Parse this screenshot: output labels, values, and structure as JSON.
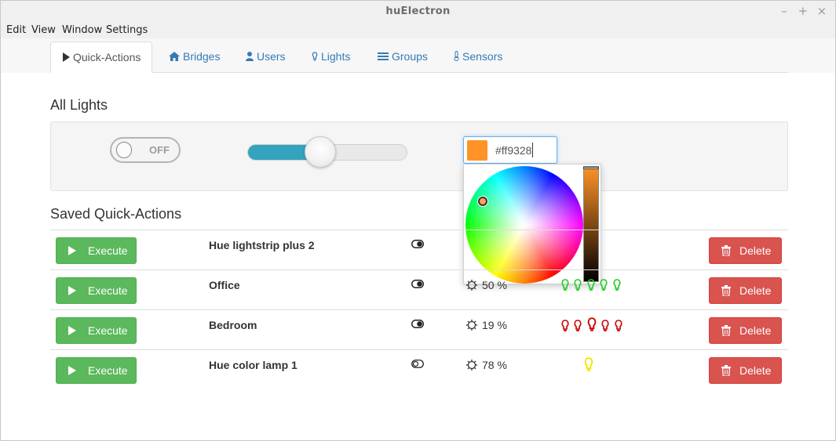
{
  "window": {
    "title": "huElectron",
    "controls": [
      "–",
      "+",
      "×"
    ]
  },
  "menu": [
    "Edit",
    "View",
    "Window",
    "Settings"
  ],
  "tabs": [
    {
      "label": "Quick-Actions",
      "icon": "play-icon",
      "active": true
    },
    {
      "label": "Bridges",
      "icon": "home-icon"
    },
    {
      "label": "Users",
      "icon": "user-icon"
    },
    {
      "label": "Lights",
      "icon": "lightbulb-icon"
    },
    {
      "label": "Groups",
      "icon": "list-icon"
    },
    {
      "label": "Sensors",
      "icon": "thermometer-icon"
    }
  ],
  "all_lights": {
    "heading": "All Lights",
    "toggle_label": "OFF",
    "brightness_fraction": 0.45,
    "color_value": "#ff9328",
    "color_hex": "#ff9328"
  },
  "saved": {
    "heading": "Saved Quick-Actions",
    "execute_label": "Execute",
    "delete_label": "Delete",
    "rows": [
      {
        "name": "Hue lightstrip plus 2",
        "toggle": "on",
        "brightness": "",
        "bulb_color": "",
        "bulb_count": 0
      },
      {
        "name": "Office",
        "toggle": "on",
        "brightness": "50 %",
        "bulb_color": "#22cc22",
        "bulb_count": 5
      },
      {
        "name": "Bedroom",
        "toggle": "on",
        "brightness": "19 %",
        "bulb_color": "#cc0000",
        "bulb_count": 5
      },
      {
        "name": "Hue color lamp 1",
        "toggle": "off",
        "brightness": "78 %",
        "bulb_color": "#f2e600",
        "bulb_count": 1
      }
    ]
  },
  "colors": {
    "primary": "#337ab7",
    "success": "#5cb85c",
    "danger": "#d9534f",
    "slider": "#35a3bd"
  }
}
